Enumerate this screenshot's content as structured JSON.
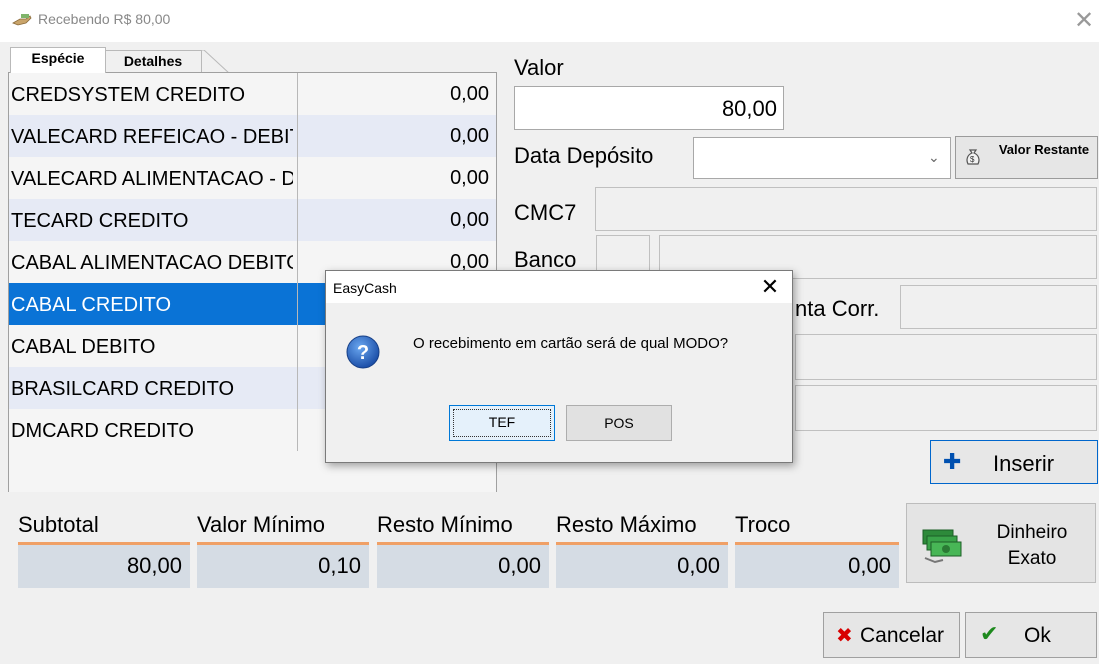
{
  "window": {
    "title": "Recebendo R$ 80,00",
    "close_glyph": "✕"
  },
  "tabs": [
    {
      "label": "Espécie",
      "active": true
    },
    {
      "label": "Detalhes",
      "active": false
    }
  ],
  "payment_list": [
    {
      "name": "CREDSYSTEM CREDITO",
      "value": "0,00"
    },
    {
      "name": "VALECARD REFEICAO - DEBITO",
      "value": "0,00"
    },
    {
      "name": "VALECARD ALIMENTACAO - DEBITO",
      "value": "0,00"
    },
    {
      "name": "TECARD CREDITO",
      "value": "0,00"
    },
    {
      "name": "CABAL ALIMENTACAO DEBITO",
      "value": "0,00"
    },
    {
      "name": "CABAL CREDITO",
      "value": "",
      "selected": true
    },
    {
      "name": "CABAL DEBITO",
      "value": ""
    },
    {
      "name": "BRASILCARD CREDITO",
      "value": ""
    },
    {
      "name": "DMCARD CREDITO",
      "value": ""
    }
  ],
  "form": {
    "valor_label": "Valor",
    "valor_value": "80,00",
    "data_deposito_label": "Data Depósito",
    "valor_restante_label": "Valor Restante",
    "cmc7_label": "CMC7",
    "banco_label": "Banco",
    "conta_corr_label": "nta Corr.",
    "inserir_label": "Inserir"
  },
  "totals": {
    "subtotal_label": "Subtotal",
    "subtotal_value": "80,00",
    "valor_minimo_label": "Valor Mínimo",
    "valor_minimo_value": "0,10",
    "resto_minimo_label": "Resto Mínimo",
    "resto_minimo_value": "0,00",
    "resto_maximo_label": "Resto Máximo",
    "resto_maximo_value": "0,00",
    "troco_label": "Troco",
    "troco_value": "0,00",
    "dinheiro_exato_label": "Dinheiro Exato"
  },
  "actions": {
    "cancelar_label": "Cancelar",
    "ok_label": "Ok"
  },
  "dialog": {
    "title": "EasyCash",
    "message": "O recebimento em cartão será de qual MODO?",
    "tef_label": "TEF",
    "pos_label": "POS",
    "close_glyph": "✕"
  },
  "colors": {
    "selection": "#0a73d6",
    "focus_border": "#0078d7",
    "cancel_red": "#d80000",
    "ok_green": "#1e8a1e",
    "totals_bg": "#d5dce4",
    "totals_accent": "#f0a066"
  },
  "icons": {
    "title": "hand-money-icon",
    "valor_restante": "money-bag-icon",
    "inserir": "plus-icon",
    "dinheiro_exato": "cash-stack-icon",
    "cancelar": "x-icon",
    "ok": "check-icon",
    "dialog": "question-icon"
  }
}
